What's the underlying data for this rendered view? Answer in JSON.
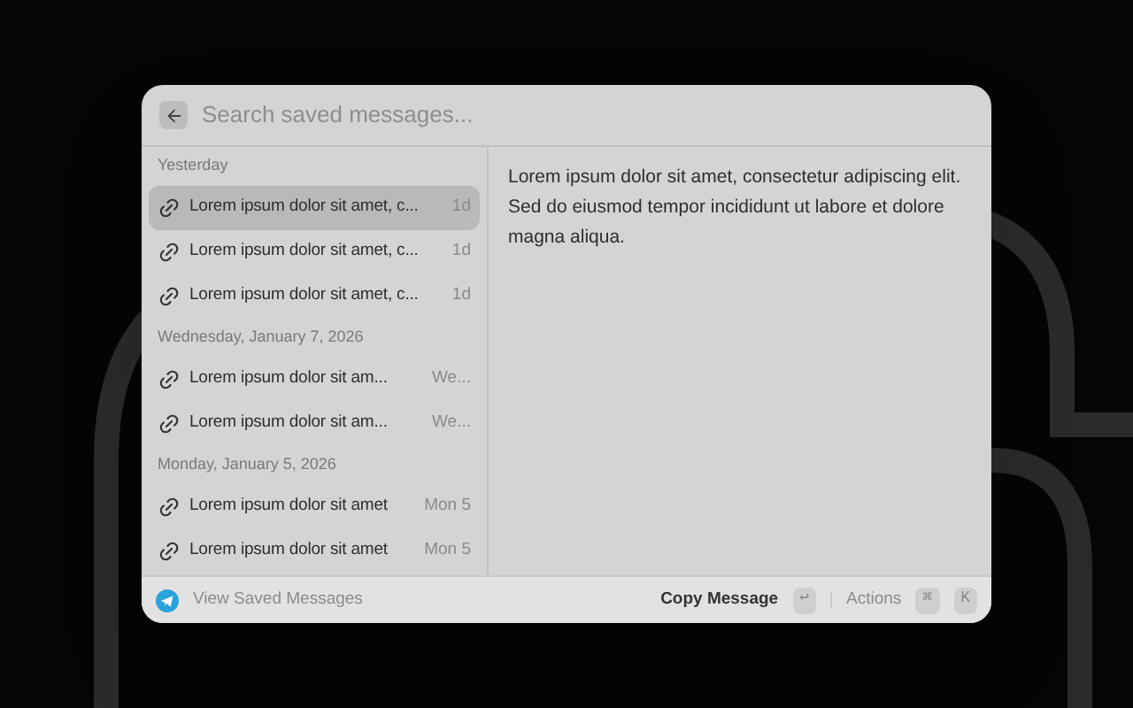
{
  "search": {
    "placeholder": "Search saved messages..."
  },
  "sections": [
    {
      "title": "Yesterday",
      "items": [
        {
          "text": "Lorem ipsum dolor sit amet, c...",
          "time": "1d",
          "selected": true
        },
        {
          "text": "Lorem ipsum dolor sit amet, c...",
          "time": "1d",
          "selected": false
        },
        {
          "text": "Lorem ipsum dolor sit amet, c...",
          "time": "1d",
          "selected": false
        }
      ]
    },
    {
      "title": "Wednesday, January 7, 2026",
      "items": [
        {
          "text": "Lorem ipsum dolor sit am...",
          "time": "We...",
          "selected": false
        },
        {
          "text": "Lorem ipsum dolor sit am...",
          "time": "We...",
          "selected": false
        }
      ]
    },
    {
      "title": "Monday, January 5, 2026",
      "items": [
        {
          "text": "Lorem ipsum dolor sit amet",
          "time": "Mon 5",
          "selected": false
        },
        {
          "text": "Lorem ipsum dolor sit amet",
          "time": "Mon 5",
          "selected": false
        }
      ]
    }
  ],
  "detail": "Lorem ipsum dolor sit amet, consectetur adipiscing elit. Sed do eiusmod tempor incididunt ut labore et dolore magna aliqua.",
  "footer": {
    "title": "View Saved Messages",
    "primary_action": "Copy Message",
    "primary_key": "↩",
    "secondary_action": "Actions",
    "keys": [
      "⌘",
      "K"
    ]
  }
}
